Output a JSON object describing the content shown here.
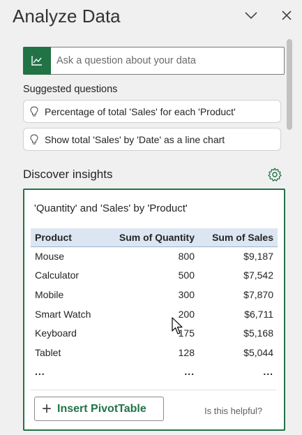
{
  "pane": {
    "title": "Analyze Data"
  },
  "ask": {
    "placeholder": "Ask a question about your data"
  },
  "suggested": {
    "label": "Suggested questions",
    "items": [
      "Percentage of total 'Sales' for each 'Product'",
      "Show total 'Sales' by 'Date' as a line chart"
    ]
  },
  "discover": {
    "title": "Discover insights"
  },
  "insight": {
    "title": "'Quantity' and 'Sales' by 'Product'",
    "columns": [
      "Product",
      "Sum of Quantity",
      "Sum of Sales"
    ],
    "rows": [
      [
        "Mouse",
        "800",
        "$9,187"
      ],
      [
        "Calculator",
        "500",
        "$7,542"
      ],
      [
        "Mobile",
        "300",
        "$7,870"
      ],
      [
        "Smart Watch",
        "200",
        "$6,711"
      ],
      [
        "Keyboard",
        "175",
        "$5,168"
      ],
      [
        "Tablet",
        "128",
        "$5,044"
      ],
      [
        "...",
        "...",
        "..."
      ]
    ],
    "insert_label": "Insert PivotTable",
    "helpful_label": "Is this helpful?"
  },
  "colors": {
    "accent": "#217346",
    "header_row": "#dce6f2"
  }
}
